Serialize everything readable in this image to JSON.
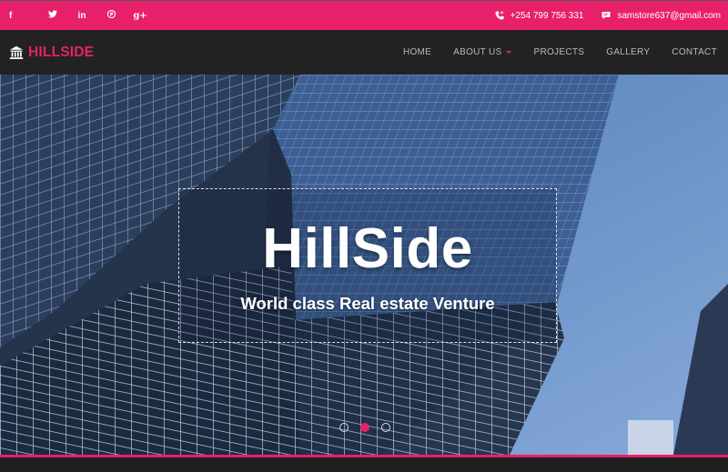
{
  "topbar": {
    "social": [
      {
        "label": "f",
        "icon": "facebook-icon"
      },
      {
        "label": "t",
        "icon": "twitter-icon"
      },
      {
        "label": "in",
        "icon": "linkedin-icon"
      },
      {
        "label": "p",
        "icon": "pinterest-icon"
      },
      {
        "label": "g+",
        "icon": "google-plus-icon"
      }
    ],
    "phone": "+254 799 756 331",
    "email": "samstore637@gmail.com"
  },
  "nav": {
    "brand": "HILLSIDE",
    "items": [
      "HOME",
      "ABOUT US",
      "PROJECTS",
      "GALLERY",
      "CONTACT"
    ]
  },
  "hero": {
    "title": "HillSide",
    "subtitle": "World class Real estate Venture",
    "slides": 3,
    "active_slide": 2
  },
  "colors": {
    "accent": "#e8206c",
    "navbar": "#222222"
  }
}
